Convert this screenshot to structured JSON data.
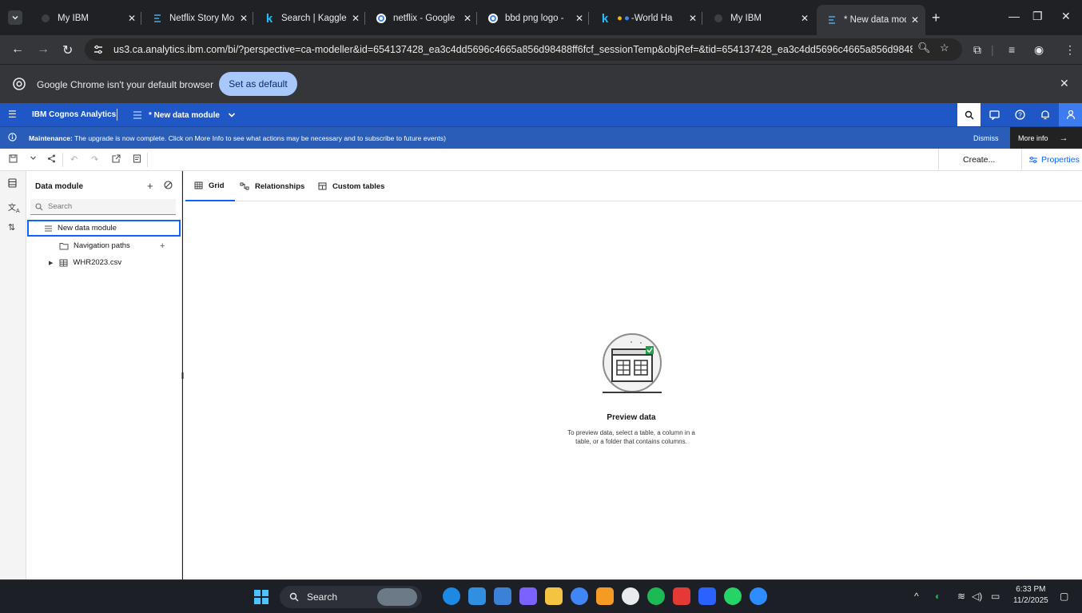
{
  "browser": {
    "tabs": [
      {
        "title": "My IBM"
      },
      {
        "title": "Netflix Story Mo"
      },
      {
        "title": "Search | Kaggle"
      },
      {
        "title": "netflix - Google"
      },
      {
        "title": "bbd png logo -"
      },
      {
        "title": "-World Ha"
      },
      {
        "title": "My IBM"
      },
      {
        "title": "* New data mod"
      }
    ],
    "url": "us3.ca.analytics.ibm.com/bi/?perspective=ca-modeller&id=654137428_ea3c4dd5696c4665a856d98488ff6fcf_sessionTemp&objRef=&tid=654137428_ea3c4dd5696c4665a856d98488..."
  },
  "infobar": {
    "message": "Google Chrome isn't your default browser",
    "button": "Set as default"
  },
  "app": {
    "product": "IBM Cognos Analytics",
    "module_name": "* New data module"
  },
  "banner": {
    "label": "Maintenance:",
    "text": " The upgrade is now complete. Click on More Info to see what actions may be necessary and to subscribe to future events)",
    "dismiss": "Dismiss",
    "more": "More info"
  },
  "toolbar": {
    "create": "Create...",
    "properties": "Properties"
  },
  "panel": {
    "title": "Data module",
    "search_placeholder": "Search",
    "tree": [
      {
        "label": "New data module"
      },
      {
        "label": "Navigation paths"
      },
      {
        "label": "WHR2023.csv"
      }
    ]
  },
  "main": {
    "tabs": [
      {
        "label": "Grid"
      },
      {
        "label": "Relationships"
      },
      {
        "label": "Custom tables"
      }
    ],
    "empty_title": "Preview data",
    "empty_desc": "To preview data, select a table, a column in a table, or a folder that contains columns."
  },
  "taskbar": {
    "search": "Search",
    "time": "6:33 PM",
    "date": "11/2/2025"
  },
  "colors": {
    "ibm_blue": "#1f57c6",
    "accent": "#0f62fe",
    "banner": "#2a5db8"
  }
}
